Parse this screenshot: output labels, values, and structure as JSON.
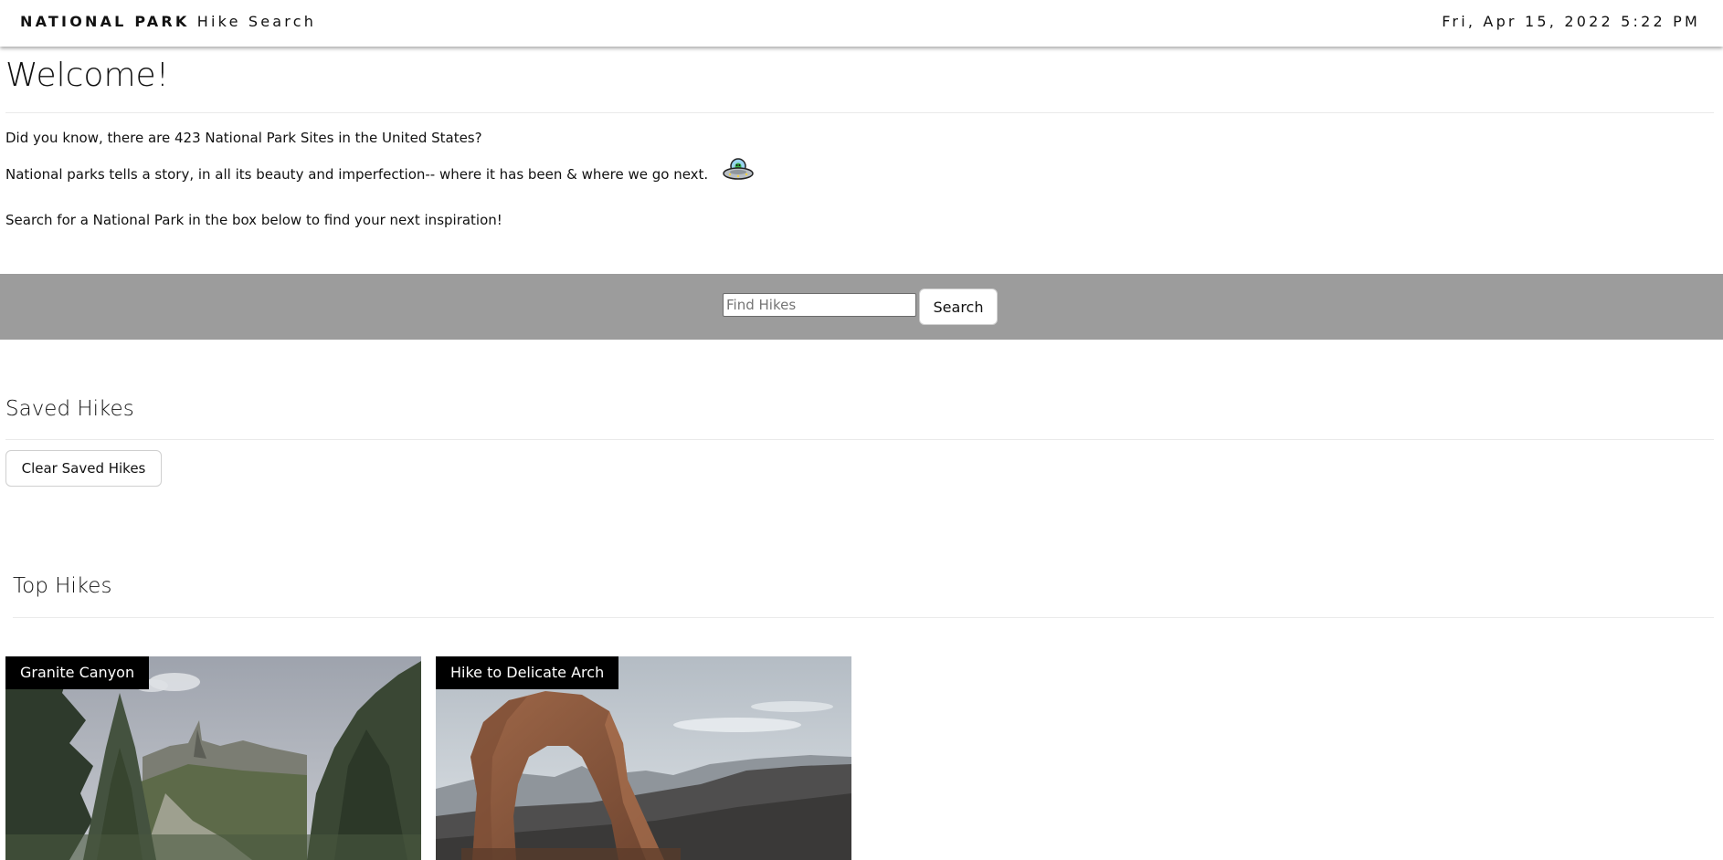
{
  "navbar": {
    "brand_bold": "NATIONAL PARK",
    "brand_light": "Hike Search",
    "datetime": "Fri, Apr 15, 2022 5:22 PM"
  },
  "welcome": {
    "title": "Welcome!",
    "line1": "Did you know, there are 423 National Park Sites in the United States?",
    "line2": "National parks tells a story, in all its beauty and imperfection-- where it has been & where we go next.",
    "line2_icon": "ufo-icon",
    "line3": "Search for a National Park in the box below to find your next inspiration!"
  },
  "search": {
    "placeholder": "Find Hikes",
    "value": "",
    "button_label": "Search",
    "band_color": "#9c9c9c"
  },
  "saved": {
    "title": "Saved Hikes",
    "clear_label": "Clear Saved Hikes"
  },
  "top_hikes": {
    "title": "Top Hikes",
    "cards": [
      {
        "label": "Granite Canyon",
        "image": "mountain-forest-photo"
      },
      {
        "label": "Hike to Delicate Arch",
        "image": "red-rock-arch-photo"
      }
    ]
  }
}
